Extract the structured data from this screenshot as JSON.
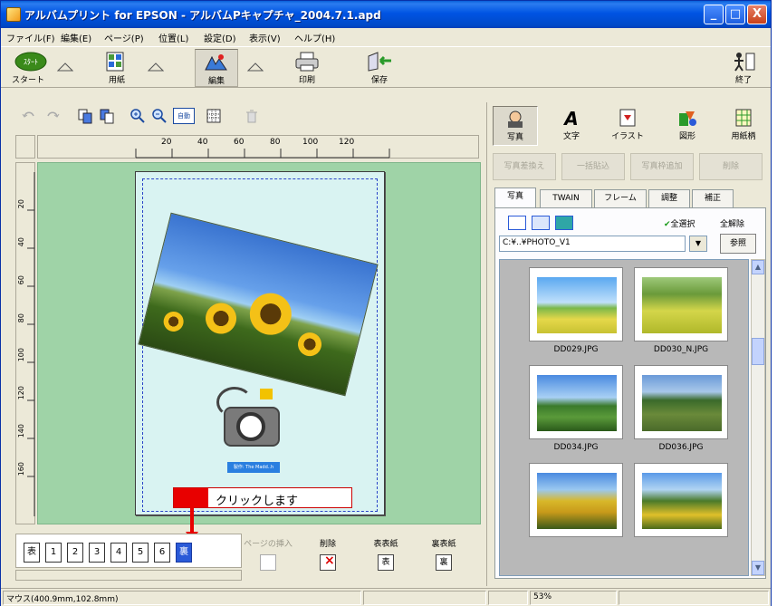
{
  "window": {
    "title": "アルバムプリント for EPSON - アルバムPキャプチャ_2004.7.1.apd",
    "minimize_label": "_",
    "maximize_label": "□",
    "close_label": "X"
  },
  "menu": [
    "ファイル(F)",
    "編集(E)",
    "ページ(P)",
    "位置(L)",
    "設定(D)",
    "表示(V)",
    "ヘルプ(H)"
  ],
  "main_toolbar": {
    "start": "スタート",
    "paper": "用紙",
    "edit": "編集",
    "print": "印刷",
    "save": "保存",
    "exit": "終了",
    "start_badge": "ｽﾀｰﾄ"
  },
  "sub_toolbar": {
    "auto_label": "自動"
  },
  "ruler": {
    "top_ticks": [
      "20",
      "40",
      "60",
      "80",
      "100",
      "120"
    ],
    "left_ticks": [
      "20",
      "40",
      "60",
      "80",
      "100",
      "120",
      "140",
      "160"
    ]
  },
  "canvas": {
    "name_tag": "製作: The Madd..h"
  },
  "callout": {
    "text": "クリックします"
  },
  "page_strip": {
    "pages": [
      "表",
      "1",
      "2",
      "3",
      "4",
      "5",
      "6",
      "裏"
    ],
    "selected": "裏"
  },
  "page_buttons": {
    "insert": "ページの挿入",
    "delete": "削除",
    "front_cover": "表表紙",
    "back_cover": "裏表紙",
    "front_icon": "表",
    "back_icon": "裏"
  },
  "statusbar": {
    "mouse": "マウス(400.9mm,102.8mm)",
    "zoom": "53%"
  },
  "right_panel": {
    "tools": [
      "写真",
      "文字",
      "イラスト",
      "図形",
      "用紙柄"
    ],
    "actions": [
      "写真差換え",
      "一括貼込",
      "写真枠追加",
      "削除"
    ],
    "tabs": [
      "写真",
      "TWAIN",
      "フレーム",
      "調整",
      "補正"
    ],
    "select_all": "全選択",
    "deselect_all": "全解除",
    "path": "C:¥..¥PHOTO_V1",
    "browse": "参照",
    "thumbnails": [
      {
        "label": "DD029.JPG"
      },
      {
        "label": "DD030_N.JPG"
      },
      {
        "label": "DD034.JPG"
      },
      {
        "label": "DD036.JPG"
      },
      {
        "label": ""
      },
      {
        "label": ""
      }
    ]
  },
  "colors": {
    "title_bar": "#0054e3",
    "canvas_bg": "#9fd3a7",
    "page_bg": "#d9f3f2",
    "callout_red": "#e80000",
    "selected_page": "#2a5ad8"
  }
}
